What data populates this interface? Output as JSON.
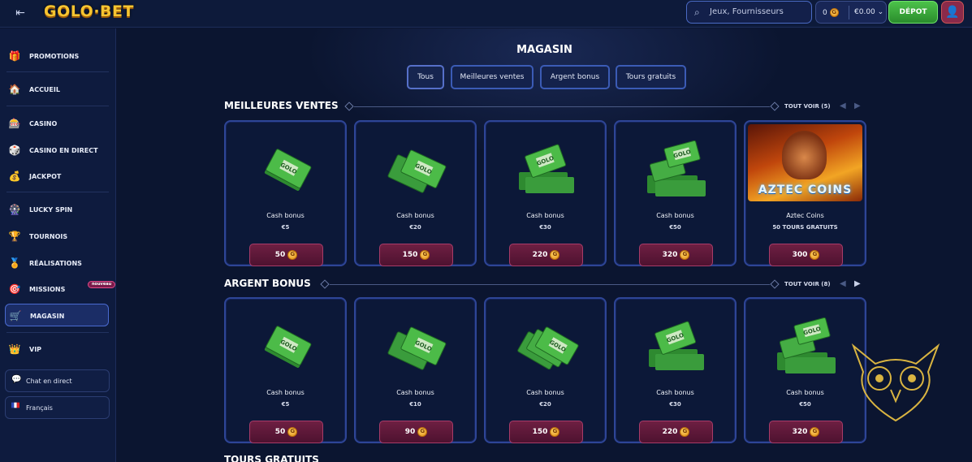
{
  "header": {
    "logo": "GOLO·BET",
    "search_placeholder": "Jeux, Fournisseurs",
    "points": "0",
    "balance": "€0.00",
    "deposit_label": "DÉPOT"
  },
  "sidebar": {
    "items": [
      {
        "label": "Promotions",
        "icon": "gift-icon"
      },
      {
        "label": "Accueil",
        "icon": "home-icon"
      },
      {
        "label": "Casino",
        "icon": "casino-icon"
      },
      {
        "label": "Casino en direct",
        "icon": "live-casino-icon"
      },
      {
        "label": "Jackpot",
        "icon": "jackpot-icon"
      },
      {
        "label": "Lucky Spin",
        "icon": "wheel-icon"
      },
      {
        "label": "Tournois",
        "icon": "trophy-icon"
      },
      {
        "label": "Réalisations",
        "icon": "medal-icon"
      },
      {
        "label": "Missions",
        "icon": "target-icon",
        "badge": "nouveau"
      },
      {
        "label": "Magasin",
        "icon": "shop-icon",
        "active": true
      },
      {
        "label": "VIP",
        "icon": "crown-icon"
      }
    ],
    "chat_label": "Chat en direct",
    "language_label": "Français"
  },
  "main": {
    "title": "MAGASIN",
    "tabs": [
      {
        "label": "Tous",
        "active": true
      },
      {
        "label": "Meilleures ventes"
      },
      {
        "label": "Argent bonus"
      },
      {
        "label": "Tours gratuits"
      }
    ],
    "sections": [
      {
        "title": "Meilleures ventes",
        "see_all": "Tout voir (5)",
        "cards": [
          {
            "name": "Cash bonus",
            "sub": "€5",
            "price": "50"
          },
          {
            "name": "Cash bonus",
            "sub": "€20",
            "price": "150"
          },
          {
            "name": "Cash bonus",
            "sub": "€30",
            "price": "220"
          },
          {
            "name": "Cash bonus",
            "sub": "€50",
            "price": "320"
          },
          {
            "name": "Aztec Coins",
            "sub": "50 TOURS GRATUITS",
            "price": "300",
            "image_title": "AZTEC COINS"
          }
        ]
      },
      {
        "title": "Argent bonus",
        "see_all": "Tout voir (8)",
        "cards": [
          {
            "name": "Cash bonus",
            "sub": "€5",
            "price": "50"
          },
          {
            "name": "Cash bonus",
            "sub": "€10",
            "price": "90"
          },
          {
            "name": "Cash bonus",
            "sub": "€20",
            "price": "150"
          },
          {
            "name": "Cash bonus",
            "sub": "€30",
            "price": "220"
          },
          {
            "name": "Cash bonus",
            "sub": "€50",
            "price": "320"
          }
        ]
      },
      {
        "title": "Tours gratuits"
      }
    ],
    "cash_stamp": "GOLO"
  }
}
